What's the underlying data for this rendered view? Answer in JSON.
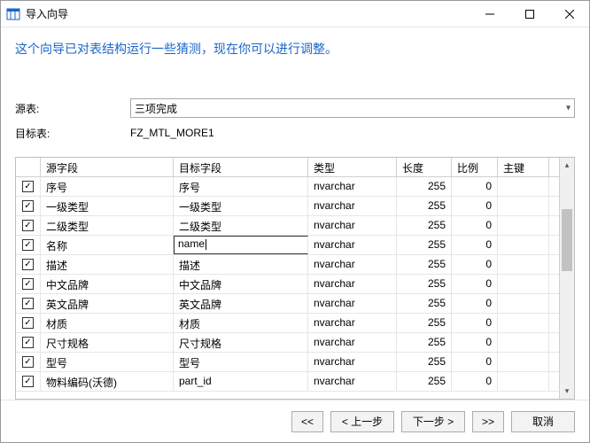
{
  "window": {
    "title": "导入向导"
  },
  "instruction": "这个向导已对表结构运行一些猜测，现在你可以进行调整。",
  "form": {
    "sourceLabel": "源表:",
    "sourceValue": "三项完成",
    "targetLabel": "目标表:",
    "targetValue": "FZ_MTL_MORE1"
  },
  "columns": {
    "source": "源字段",
    "target": "目标字段",
    "type": "类型",
    "length": "长度",
    "ratio": "比例",
    "pk": "主键"
  },
  "rows": [
    {
      "src": "序号",
      "tgt": "序号",
      "type": "nvarchar",
      "len": "255",
      "ratio": "0",
      "editing": false
    },
    {
      "src": "一级类型",
      "tgt": "一级类型",
      "type": "nvarchar",
      "len": "255",
      "ratio": "0",
      "editing": false
    },
    {
      "src": "二级类型",
      "tgt": "二级类型",
      "type": "nvarchar",
      "len": "255",
      "ratio": "0",
      "editing": false
    },
    {
      "src": "名称",
      "tgt": "name",
      "type": "nvarchar",
      "len": "255",
      "ratio": "0",
      "editing": true
    },
    {
      "src": "描述",
      "tgt": "描述",
      "type": "nvarchar",
      "len": "255",
      "ratio": "0",
      "editing": false
    },
    {
      "src": "中文品牌",
      "tgt": "中文品牌",
      "type": "nvarchar",
      "len": "255",
      "ratio": "0",
      "editing": false
    },
    {
      "src": "英文品牌",
      "tgt": "英文品牌",
      "type": "nvarchar",
      "len": "255",
      "ratio": "0",
      "editing": false
    },
    {
      "src": "材质",
      "tgt": "材质",
      "type": "nvarchar",
      "len": "255",
      "ratio": "0",
      "editing": false
    },
    {
      "src": "尺寸规格",
      "tgt": "尺寸规格",
      "type": "nvarchar",
      "len": "255",
      "ratio": "0",
      "editing": false
    },
    {
      "src": "型号",
      "tgt": "型号",
      "type": "nvarchar",
      "len": "255",
      "ratio": "0",
      "editing": false
    },
    {
      "src": "物料编码(沃德)",
      "tgt": "part_id",
      "type": "nvarchar",
      "len": "255",
      "ratio": "0",
      "editing": false
    }
  ],
  "editingRowIndex": 3,
  "buttons": {
    "first": "<<",
    "prev": "< 上一步",
    "next": "下一步 >",
    "last": ">>",
    "cancel": "取消"
  }
}
